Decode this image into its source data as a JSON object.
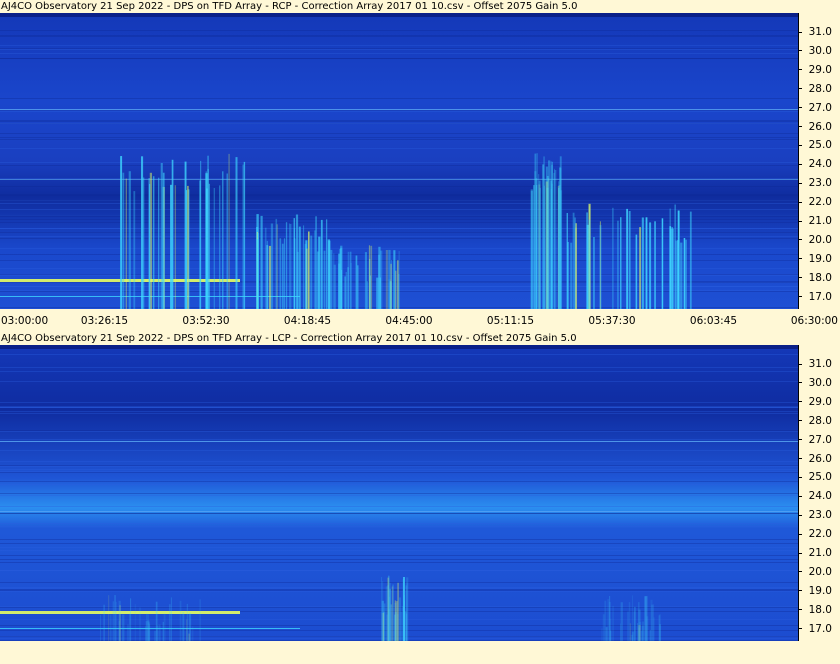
{
  "panels": [
    {
      "title": "AJ4CO Observatory 21 Sep 2022  -  DPS on TFD Array  -  RCP  -  Correction Array 2017 01 10.csv  -  Offset 2075  Gain 5.0",
      "polarization": "RCP",
      "freq_ticks": [
        "31.0",
        "30.0",
        "29.0",
        "28.0",
        "27.0",
        "26.0",
        "25.0",
        "24.0",
        "23.0",
        "22.0",
        "21.0",
        "20.0",
        "19.0",
        "18.0",
        "17.0"
      ]
    },
    {
      "title": "AJ4CO Observatory 21 Sep 2022  -  DPS on TFD Array  -  LCP  -  Correction Array 2017 01 10.csv  -  Offset 2075  Gain 5.0",
      "polarization": "LCP",
      "freq_ticks": [
        "31.0",
        "30.0",
        "29.0",
        "28.0",
        "27.0",
        "26.0",
        "25.0",
        "24.0",
        "23.0",
        "22.0",
        "21.0",
        "20.0",
        "19.0",
        "18.0",
        "17.0"
      ]
    }
  ],
  "time_ticks": [
    "03:00:00",
    "03:26:15",
    "03:52:30",
    "04:18:45",
    "04:45:00",
    "05:11:15",
    "05:37:30",
    "06:03:45",
    "06:30:00"
  ],
  "colors": {
    "background": "#fff8d6",
    "spectrogram_base": "#1a44c8",
    "spectrogram_dark": "#0e2a9a",
    "burst_cyan": "#3fd8ff",
    "burst_yellow": "#e8ff60"
  }
}
